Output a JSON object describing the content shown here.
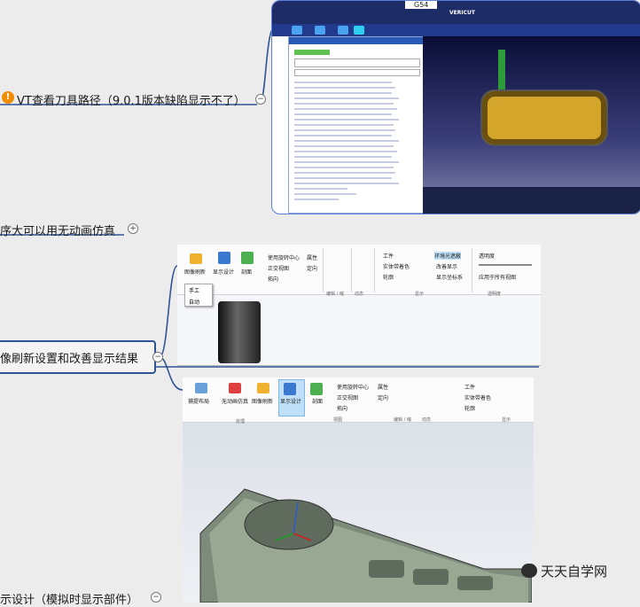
{
  "nodes": {
    "vt_path": "VT查看刀具路径（9.0.1版本缺陷显示不了）",
    "no_anim": "序大可以用无动画仿真",
    "refresh": "像刷新设置和改善显示结果",
    "display": "示设计（模拟时显示部件）"
  },
  "shot1": {
    "g54": "G54",
    "brand": "VERICUT",
    "lines": [
      "X370.7990 Y5.0000 Z-1.5000 A0.0000",
      "X370.7990 Y5.0000 Z-1.5000 A0.0000"
    ]
  },
  "shot2": {
    "ribbon": {
      "img_refresh": "图像刷新",
      "show_design": "显示设计",
      "section": "剖面",
      "rotate_center": "使用旋转中心",
      "front_view": "正交视图",
      "zoom": "拓向",
      "attr": "属性",
      "position": "定向",
      "workpiece": "工件",
      "solid_color": "实体带着色",
      "edge": "轮廓",
      "env_light": "环境光遮蔽",
      "improve": "改善显示",
      "show_coord": "显示坐标系",
      "transparency": "透明度",
      "apply_all": "应用于所有视图",
      "group_view": "视图",
      "group_edit": "编辑 / 缩",
      "group_dynamic": "动态",
      "group_show": "显示",
      "group_trans": "透明度"
    },
    "dropdown": [
      "手工",
      "自动"
    ]
  },
  "shot3": {
    "ribbon": {
      "capture_layout": "捕提布局",
      "no_anim_sim": "无动画仿真",
      "img_refresh": "图像刷新",
      "show_design": "显示设计",
      "section": "剖面",
      "rotate_center": "使用旋转中心",
      "front_view": "正交视图",
      "zoom": "拓向",
      "attr": "属性",
      "position": "定向",
      "workpiece": "工件",
      "solid_color": "实体带着色",
      "edge": "轮廓",
      "group_process": "处理",
      "group_view": "视图",
      "group_edit": "编辑 / 缩",
      "group_dynamic": "动态",
      "group_show": "显示"
    }
  },
  "watermark": "天天自学网",
  "colors": {
    "node_line": "#2f5597",
    "arrow": "#e02020",
    "vericut_bar": "#1d2b66"
  }
}
